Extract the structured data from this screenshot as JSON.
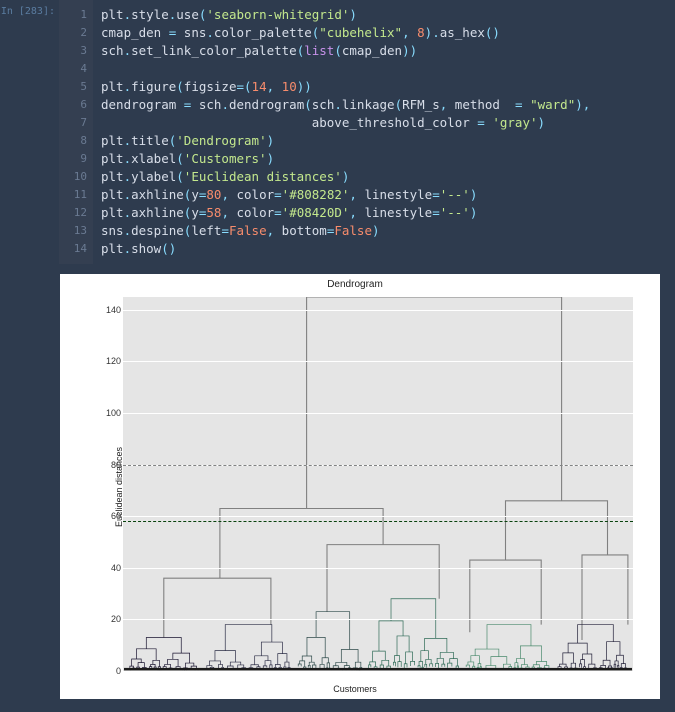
{
  "cell": {
    "prompt": "In [283]:",
    "lines": [
      {
        "n": "1",
        "html": "plt<span class='pyk'>.</span>style<span class='pyk'>.</span>use<span class='pyk'>(</span><span class='str'>'seaborn-whitegrid'</span><span class='pyk'>)</span>"
      },
      {
        "n": "2",
        "html": "cmap_den <span class='pyk'>=</span> sns<span class='pyk'>.</span>color_palette<span class='pyk'>(</span><span class='str'>\"cubehelix\"</span><span class='pyk'>,</span> <span class='num'>8</span><span class='pyk'>)</span><span class='pyk'>.</span>as_hex<span class='pyk'>()</span>"
      },
      {
        "n": "3",
        "html": "sch<span class='pyk'>.</span>set_link_color_palette<span class='pyk'>(</span><span class='kw'>list</span><span class='pyk'>(</span>cmap_den<span class='pyk'>))</span>"
      },
      {
        "n": "4",
        "html": ""
      },
      {
        "n": "5",
        "html": "plt<span class='pyk'>.</span>figure<span class='pyk'>(</span>figsize<span class='pyk'>=(</span><span class='num'>14</span><span class='pyk'>,</span> <span class='num'>10</span><span class='pyk'>))</span>"
      },
      {
        "n": "6",
        "html": "dendrogram <span class='pyk'>=</span> sch<span class='pyk'>.</span>dendrogram<span class='pyk'>(</span>sch<span class='pyk'>.</span>linkage<span class='pyk'>(</span>RFM_s<span class='pyk'>,</span> method  <span class='pyk'>=</span> <span class='str'>\"ward\"</span><span class='pyk'>),</span>"
      },
      {
        "n": "7",
        "html": "                            above_threshold_color <span class='pyk'>=</span> <span class='str'>'gray'</span><span class='pyk'>)</span>"
      },
      {
        "n": "8",
        "html": "plt<span class='pyk'>.</span>title<span class='pyk'>(</span><span class='str'>'Dendrogram'</span><span class='pyk'>)</span>"
      },
      {
        "n": "9",
        "html": "plt<span class='pyk'>.</span>xlabel<span class='pyk'>(</span><span class='str'>'Customers'</span><span class='pyk'>)</span>"
      },
      {
        "n": "10",
        "html": "plt<span class='pyk'>.</span>ylabel<span class='pyk'>(</span><span class='str'>'Euclidean distances'</span><span class='pyk'>)</span>"
      },
      {
        "n": "11",
        "html": "plt<span class='pyk'>.</span>axhline<span class='pyk'>(</span>y<span class='pyk'>=</span><span class='num'>80</span><span class='pyk'>,</span> color<span class='pyk'>=</span><span class='str'>'#808282'</span><span class='pyk'>,</span> linestyle<span class='pyk'>=</span><span class='str'>'--'</span><span class='pyk'>)</span>"
      },
      {
        "n": "12",
        "html": "plt<span class='pyk'>.</span>axhline<span class='pyk'>(</span>y<span class='pyk'>=</span><span class='num'>58</span><span class='pyk'>,</span> color<span class='pyk'>=</span><span class='str'>'#08420D'</span><span class='pyk'>,</span> linestyle<span class='pyk'>=</span><span class='str'>'--'</span><span class='pyk'>)</span>"
      },
      {
        "n": "13",
        "html": "sns<span class='pyk'>.</span>despine<span class='pyk'>(</span>left<span class='pyk'>=</span><span class='bool'>False</span><span class='pyk'>,</span> bottom<span class='pyk'>=</span><span class='bool'>False</span><span class='pyk'>)</span>"
      },
      {
        "n": "14",
        "html": "plt<span class='pyk'>.</span>show<span class='pyk'>()</span>"
      }
    ]
  },
  "chart_data": {
    "type": "dendrogram",
    "title": "Dendrogram",
    "xlabel": "Customers",
    "ylabel": "Euclidean distances",
    "ylim": [
      0,
      145
    ],
    "yticks": [
      0,
      20,
      40,
      60,
      80,
      100,
      120,
      140
    ],
    "hlines": [
      {
        "y": 80,
        "color": "#808282",
        "style": "dashed"
      },
      {
        "y": 58,
        "color": "#08420D",
        "style": "dashed"
      }
    ],
    "top_merge_height": 145,
    "cluster_colors": [
      "#1a1530",
      "#24223a",
      "#2d2e46",
      "#2e4a4a",
      "#2f6b57",
      "#4a8a6d",
      "#7aa690",
      "#a8bfad"
    ],
    "above_threshold_color": "gray",
    "note": "Large hierarchical clustering dendrogram of customers; leaf labels not readable at this resolution.",
    "gray_links": [
      {
        "xl": 0.36,
        "xr": 0.86,
        "y": 145,
        "yl": 63,
        "yr": 66
      },
      {
        "xl": 0.19,
        "xr": 0.51,
        "y": 63,
        "yl": 36,
        "yr": 49
      },
      {
        "xl": 0.75,
        "xr": 0.95,
        "y": 66,
        "yl": 43,
        "yr": 45
      },
      {
        "xl": 0.08,
        "xr": 0.29,
        "y": 36,
        "yl": 13,
        "yr": 18
      },
      {
        "xl": 0.4,
        "xr": 0.62,
        "y": 49,
        "yl": 23,
        "yr": 28
      },
      {
        "xl": 0.68,
        "xr": 0.82,
        "y": 43,
        "yl": 15,
        "yr": 18
      },
      {
        "xl": 0.9,
        "xr": 0.99,
        "y": 45,
        "yl": 12,
        "yr": 18
      }
    ]
  }
}
